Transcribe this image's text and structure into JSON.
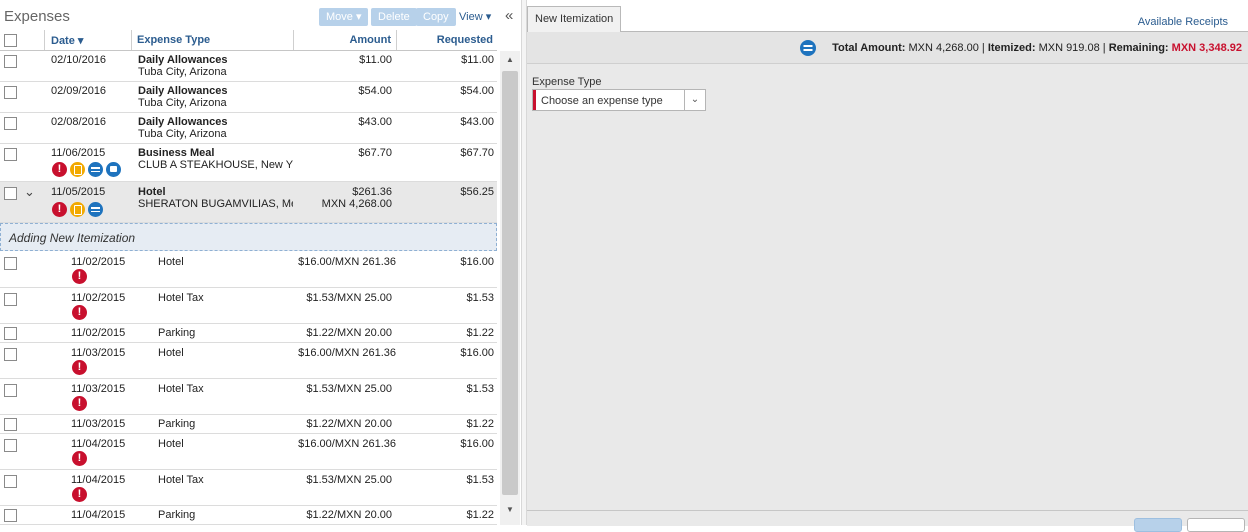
{
  "left": {
    "title": "Expenses",
    "toolbar": {
      "move": "Move ▾",
      "delete": "Delete",
      "copy": "Copy",
      "view": "View ▾",
      "collapse": "«"
    },
    "columns": {
      "date": "Date ▾",
      "type": "Expense Type",
      "amount": "Amount",
      "requested": "Requested"
    },
    "expenses": [
      {
        "date": "02/10/2016",
        "type": "Daily Allowances",
        "sub": "Tuba City, Arizona",
        "amount": "$11.00",
        "requested": "$11.00"
      },
      {
        "date": "02/09/2016",
        "type": "Daily Allowances",
        "sub": "Tuba City, Arizona",
        "amount": "$54.00",
        "requested": "$54.00"
      },
      {
        "date": "02/08/2016",
        "type": "Daily Allowances",
        "sub": "Tuba City, Arizona",
        "amount": "$43.00",
        "requested": "$43.00"
      },
      {
        "date": "11/06/2015",
        "type": "Business Meal",
        "sub": "CLUB A STEAKHOUSE, New Y",
        "amount": "$67.70",
        "requested": "$67.70"
      },
      {
        "date": "11/05/2015",
        "type": "Hotel",
        "sub": "SHERATON BUGAMVILIAS, Me",
        "amount": "$261.36",
        "amount2": "MXN 4,268.00",
        "requested": "$56.25"
      }
    ],
    "adding_label": "Adding New Itemization",
    "itemizations": [
      {
        "date": "11/02/2015",
        "type": "Hotel",
        "amount": "$16.00/MXN 261.36",
        "requested": "$16.00"
      },
      {
        "date": "11/02/2015",
        "type": "Hotel Tax",
        "amount": "$1.53/MXN 25.00",
        "requested": "$1.53"
      },
      {
        "date": "11/02/2015",
        "type": "Parking",
        "amount": "$1.22/MXN 20.00",
        "requested": "$1.22"
      },
      {
        "date": "11/03/2015",
        "type": "Hotel",
        "amount": "$16.00/MXN 261.36",
        "requested": "$16.00"
      },
      {
        "date": "11/03/2015",
        "type": "Hotel Tax",
        "amount": "$1.53/MXN 25.00",
        "requested": "$1.53"
      },
      {
        "date": "11/03/2015",
        "type": "Parking",
        "amount": "$1.22/MXN 20.00",
        "requested": "$1.22"
      },
      {
        "date": "11/04/2015",
        "type": "Hotel",
        "amount": "$16.00/MXN 261.36",
        "requested": "$16.00"
      },
      {
        "date": "11/04/2015",
        "type": "Hotel Tax",
        "amount": "$1.53/MXN 25.00",
        "requested": "$1.53"
      },
      {
        "date": "11/04/2015",
        "type": "Parking",
        "amount": "$1.22/MXN 20.00",
        "requested": "$1.22"
      }
    ]
  },
  "right": {
    "tab": "New Itemization",
    "available_receipts": "Available Receipts",
    "totals": {
      "total_label": "Total Amount:",
      "total_value": "MXN 4,268.00",
      "sep1": "|",
      "itemized_label": "Itemized:",
      "itemized_value": "MXN 919.08",
      "sep2": "|",
      "remaining_label": "Remaining:",
      "remaining_value": "MXN 3,348.92"
    },
    "field_label": "Expense Type",
    "select_value": "Choose an expense type"
  },
  "colors": {
    "accent": "#2b5c8f",
    "error": "#c8102e",
    "warning": "#f2a900",
    "info": "#1e73be"
  }
}
